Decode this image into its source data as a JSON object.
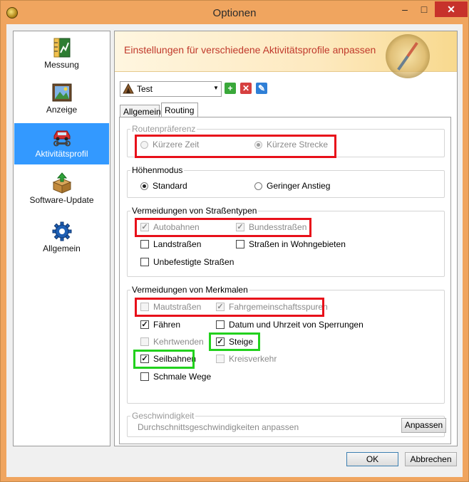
{
  "window": {
    "title": "Optionen",
    "minimize": "–",
    "maximize": "□",
    "close": "✕"
  },
  "nav": {
    "items": [
      {
        "label": "Messung",
        "icon": "ruler-chart-icon"
      },
      {
        "label": "Anzeige",
        "icon": "display-icon"
      },
      {
        "label": "Aktivitätsprofil",
        "icon": "car-wrench-icon",
        "selected": true
      },
      {
        "label": "Software-Update",
        "icon": "package-update-icon"
      },
      {
        "label": "Allgemein",
        "icon": "gear-icon"
      }
    ]
  },
  "header": {
    "text": "Einstellungen für verschiedene Aktivitätsprofile anpassen"
  },
  "profile": {
    "selected": "Test",
    "add_icon": "+",
    "delete_icon": "✕",
    "edit_icon": "✎"
  },
  "tabs": {
    "general": "Allgemein",
    "routing": "Routing",
    "active": "Routing"
  },
  "route_pref": {
    "title": "Routenpräferenz",
    "options": [
      {
        "label": "Kürzere Zeit",
        "checked": false,
        "disabled": true
      },
      {
        "label": "Kürzere Strecke",
        "checked": true,
        "disabled": true
      }
    ]
  },
  "height_mode": {
    "title": "Höhenmodus",
    "options": [
      {
        "label": "Standard",
        "checked": true
      },
      {
        "label": "Geringer Anstieg",
        "checked": false
      }
    ]
  },
  "road_avoid": {
    "title": "Vermeidungen von Straßentypen",
    "items": [
      {
        "label": "Autobahnen",
        "checked": true,
        "disabled": true
      },
      {
        "label": "Bundesstraßen",
        "checked": true,
        "disabled": true
      },
      {
        "label": "Landstraßen",
        "checked": false
      },
      {
        "label": "Straßen in Wohngebieten",
        "checked": false
      },
      {
        "label": "Unbefestigte Straßen",
        "checked": false
      }
    ]
  },
  "feature_avoid": {
    "title": "Vermeidungen von Merkmalen",
    "items": [
      {
        "label": "Mautstraßen",
        "checked": false,
        "disabled": true
      },
      {
        "label": "Fahrgemeinschaftsspuren",
        "checked": true,
        "disabled": true
      },
      {
        "label": "Fähren",
        "checked": true
      },
      {
        "label": "Datum und Uhrzeit von Sperrungen",
        "checked": false
      },
      {
        "label": "Kehrtwenden",
        "checked": false,
        "disabled": true
      },
      {
        "label": "Steige",
        "checked": true
      },
      {
        "label": "Seilbahnen",
        "checked": true
      },
      {
        "label": "Kreisverkehr",
        "checked": false,
        "disabled": true
      },
      {
        "label": "Schmale Wege",
        "checked": false
      }
    ]
  },
  "speed": {
    "title": "Geschwindigkeit",
    "description": "Durchschnittsgeschwindigkeiten anpassen",
    "button": "Anpassen"
  },
  "footer": {
    "ok": "OK",
    "cancel": "Abbrechen"
  },
  "colors": {
    "titlebar": "#f0a55f",
    "selection": "#3399ff",
    "highlight_red": "#e8101a",
    "highlight_green": "#22d11d",
    "close": "#c7322b"
  }
}
